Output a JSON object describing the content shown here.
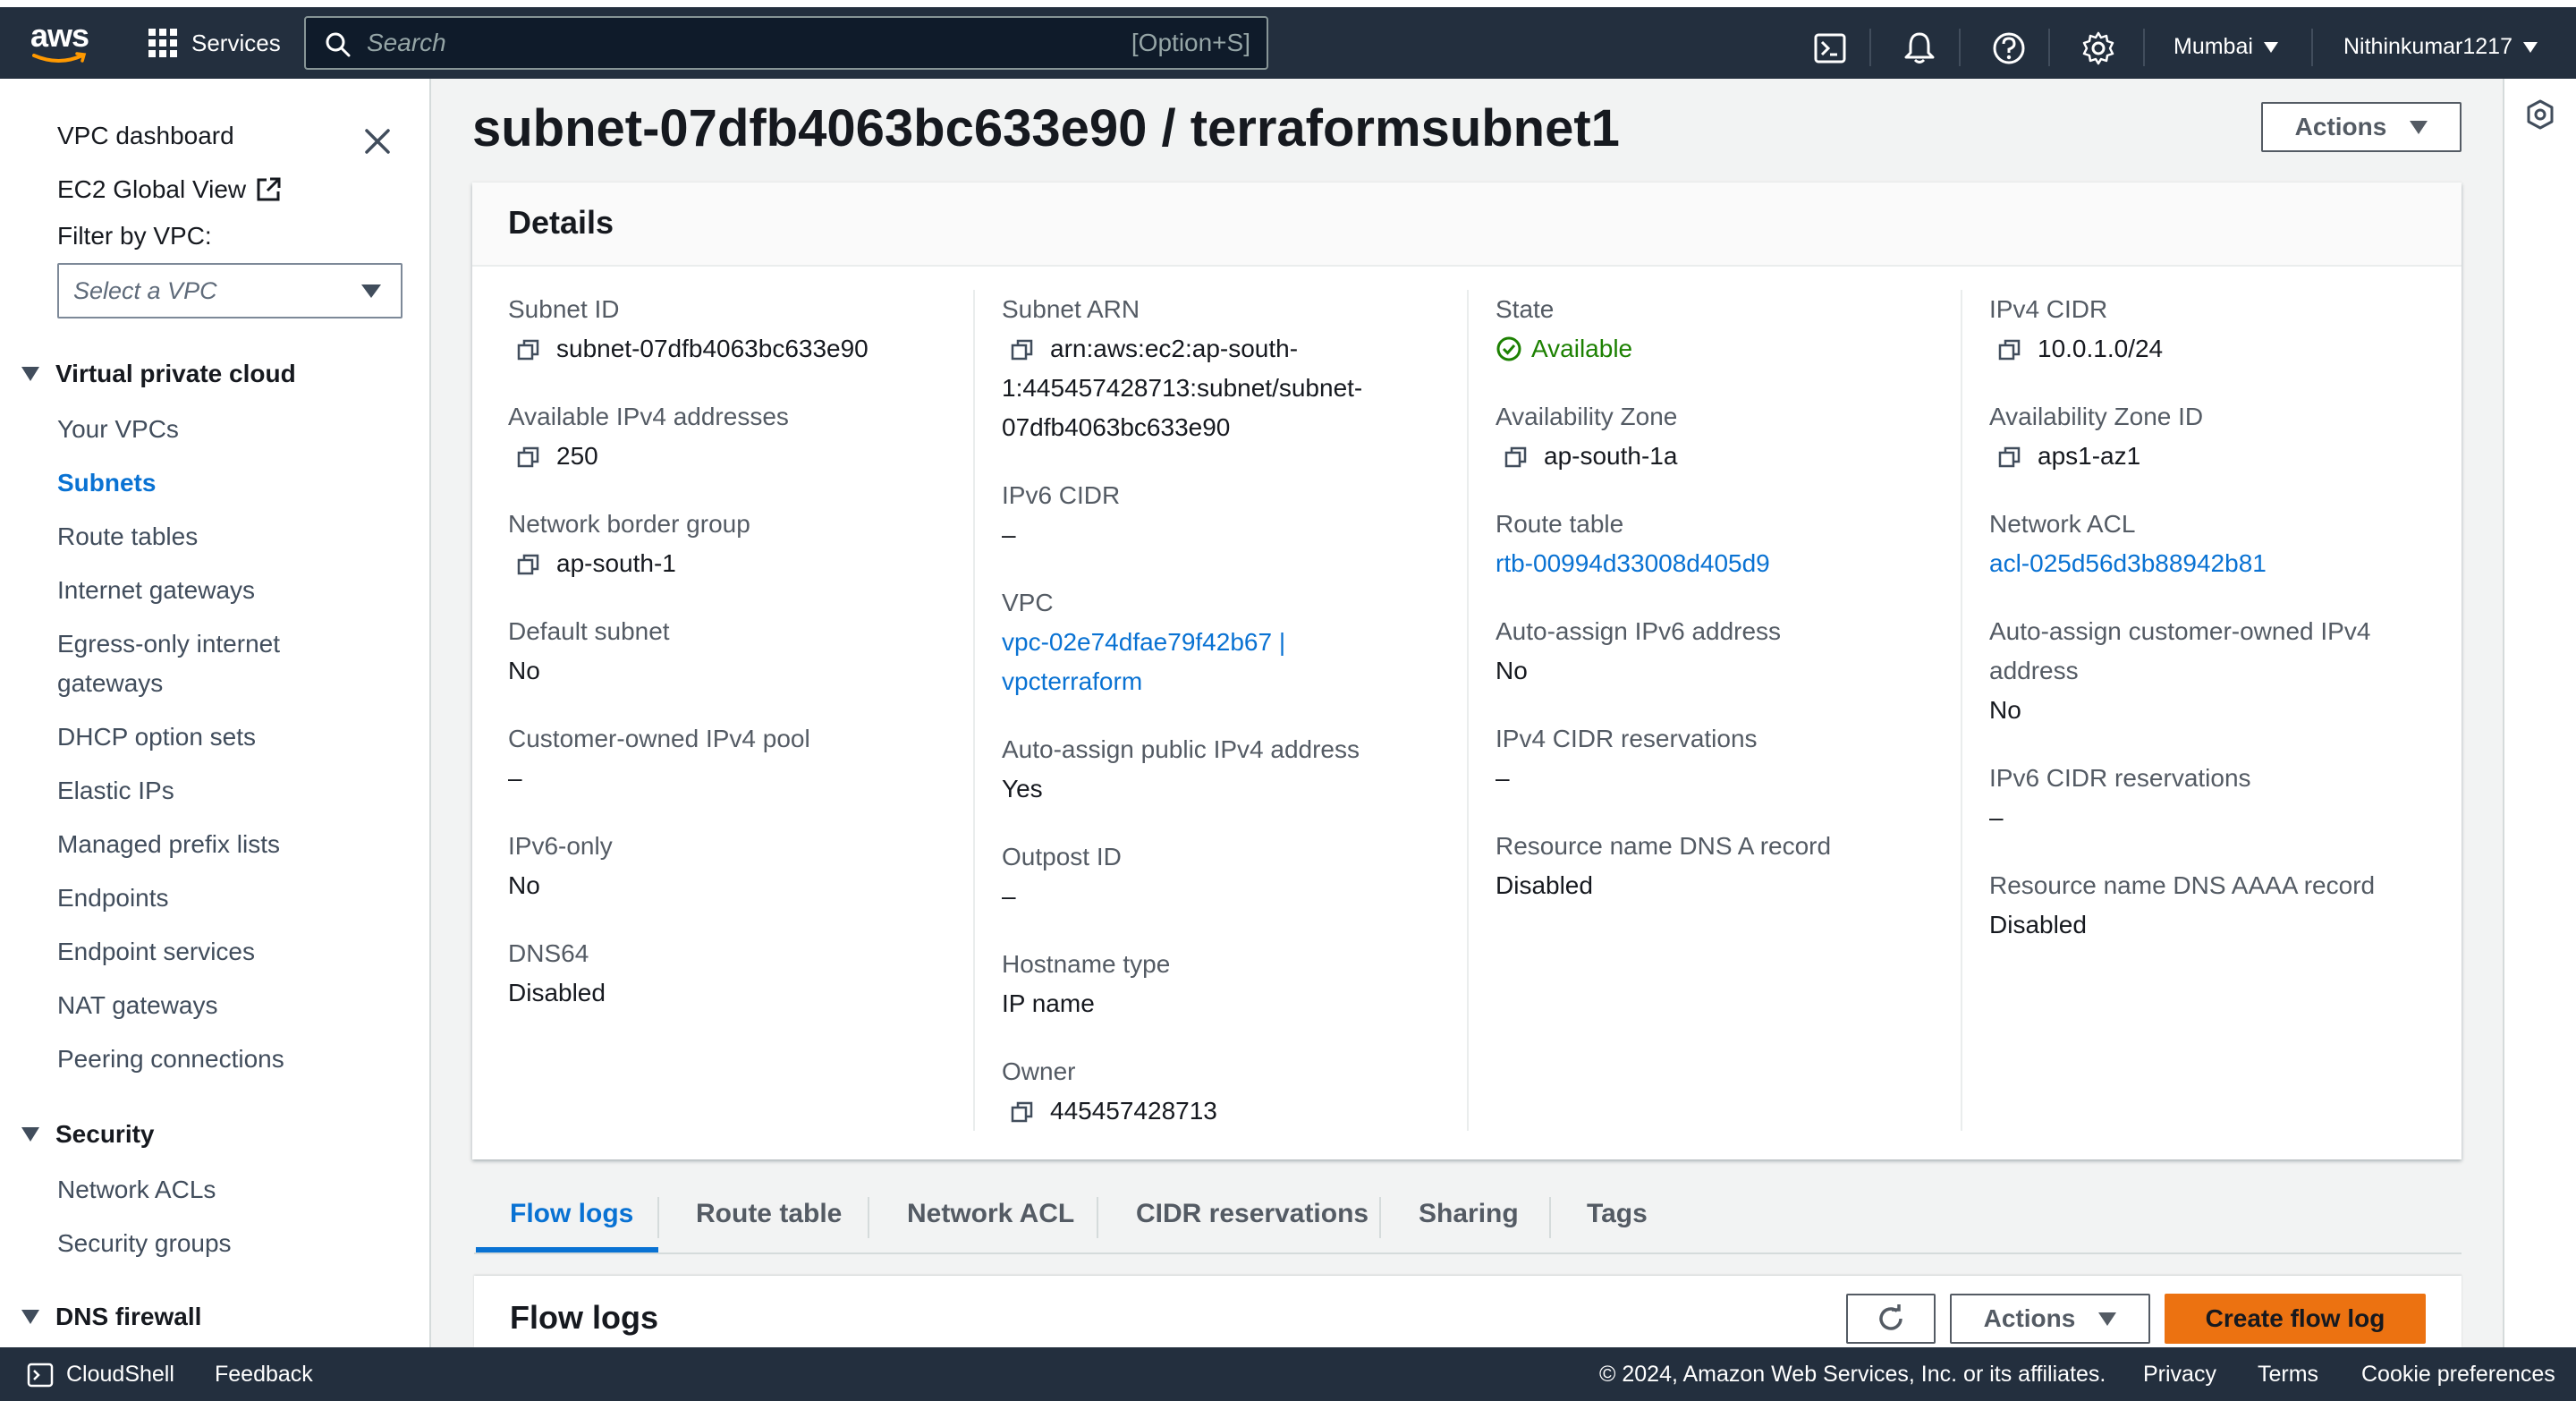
{
  "topbar": {
    "logo_text": "aws",
    "services_label": "Services",
    "search_placeholder": "Search",
    "search_shortcut": "[Option+S]",
    "region": "Mumbai",
    "user": "Nithinkumar1217"
  },
  "sidebar": {
    "vpc_dashboard": "VPC dashboard",
    "ec2_global_view": "EC2 Global View",
    "filter_label": "Filter by VPC:",
    "filter_placeholder": "Select a VPC",
    "sections": {
      "virtual_private_cloud": "Virtual private cloud",
      "security": "Security",
      "dns_firewall": "DNS firewall"
    },
    "vpc_items": [
      "Your VPCs",
      "Subnets",
      "Route tables",
      "Internet gateways",
      "Egress-only internet",
      "gateways",
      "DHCP option sets",
      "Elastic IPs",
      "Managed prefix lists",
      "Endpoints",
      "Endpoint services",
      "NAT gateways",
      "Peering connections"
    ],
    "security_items": [
      "Network ACLs",
      "Security groups"
    ]
  },
  "page": {
    "title": "subnet-07dfb4063bc633e90 / terraformsubnet1",
    "actions_label": "Actions"
  },
  "details": {
    "heading": "Details",
    "col1": [
      {
        "label": "Subnet ID",
        "value": "subnet-07dfb4063bc633e90"
      },
      {
        "label": "Available IPv4 addresses",
        "value": "250"
      },
      {
        "label": "Network border group",
        "value": "ap-south-1"
      },
      {
        "label": "Default subnet",
        "value": "No"
      },
      {
        "label": "Customer-owned IPv4 pool",
        "value": "–"
      },
      {
        "label": "IPv6-only",
        "value": "No"
      },
      {
        "label": "DNS64",
        "value": "Disabled"
      }
    ],
    "col2": [
      {
        "label": "Subnet ARN",
        "value": "arn:aws:ec2:ap-south-1:445457428713:subnet/subnet-07dfb4063bc633e90",
        "lines": [
          "arn:aws:ec2:ap-south-",
          "1:445457428713:subnet/subnet-",
          "07dfb4063bc633e90"
        ]
      },
      {
        "label": "IPv6 CIDR",
        "value": "–"
      },
      {
        "label": "VPC",
        "value": "vpc-02e74dfae79f42b67 | vpcterraform",
        "lines": [
          "vpc-02e74dfae79f42b67 |",
          "vpcterraform"
        ]
      },
      {
        "label": "Auto-assign public IPv4 address",
        "value": "Yes"
      },
      {
        "label": "Outpost ID",
        "value": "–"
      },
      {
        "label": "Hostname type",
        "value": "IP name"
      },
      {
        "label": "Owner",
        "value": "445457428713"
      }
    ],
    "col3": [
      {
        "label": "State",
        "value": "Available"
      },
      {
        "label": "Availability Zone",
        "value": "ap-south-1a"
      },
      {
        "label": "Route table",
        "value": "rtb-00994d33008d405d9"
      },
      {
        "label": "Auto-assign IPv6 address",
        "value": "No"
      },
      {
        "label": "IPv4 CIDR reservations",
        "value": "–"
      },
      {
        "label": "Resource name DNS A record",
        "value": "Disabled"
      }
    ],
    "col4": [
      {
        "label": "IPv4 CIDR",
        "value": "10.0.1.0/24"
      },
      {
        "label": "Availability Zone ID",
        "value": "aps1-az1"
      },
      {
        "label": "Network ACL",
        "value": "acl-025d56d3b88942b81"
      },
      {
        "label": "Auto-assign customer-owned IPv4",
        "label2": "address",
        "value": "No"
      },
      {
        "label": "IPv6 CIDR reservations",
        "value": "–"
      },
      {
        "label": "Resource name DNS AAAA record",
        "value": "Disabled"
      }
    ]
  },
  "tabs": [
    "Flow logs",
    "Route table",
    "Network ACL",
    "CIDR reservations",
    "Sharing",
    "Tags"
  ],
  "flow_logs": {
    "heading": "Flow logs",
    "actions_label": "Actions",
    "create_label": "Create flow log"
  },
  "footer": {
    "cloudshell": "CloudShell",
    "feedback": "Feedback",
    "copyright": "© 2024, Amazon Web Services, Inc. or its affiliates.",
    "privacy": "Privacy",
    "terms": "Terms",
    "cookies": "Cookie preferences"
  },
  "colors": {
    "nav": "#232f3e",
    "link": "#0972d3",
    "primary": "#ec7211",
    "success": "#1d8102"
  }
}
